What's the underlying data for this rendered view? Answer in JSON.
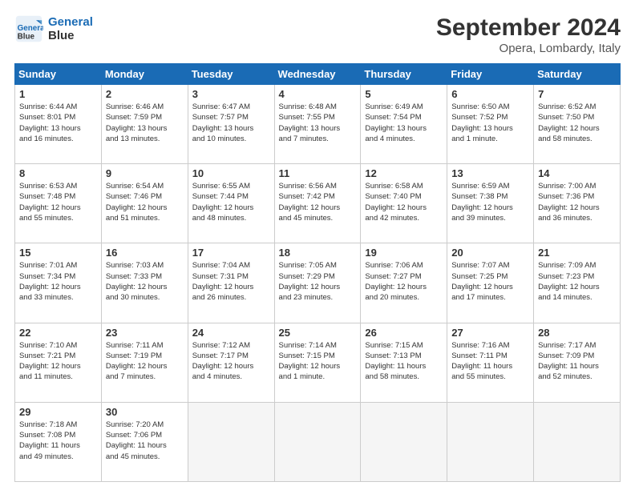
{
  "header": {
    "logo_line1": "General",
    "logo_line2": "Blue",
    "main_title": "September 2024",
    "sub_title": "Opera, Lombardy, Italy"
  },
  "calendar": {
    "days_of_week": [
      "Sunday",
      "Monday",
      "Tuesday",
      "Wednesday",
      "Thursday",
      "Friday",
      "Saturday"
    ],
    "weeks": [
      [
        {
          "day": "1",
          "detail": "Sunrise: 6:44 AM\nSunset: 8:01 PM\nDaylight: 13 hours\nand 16 minutes."
        },
        {
          "day": "2",
          "detail": "Sunrise: 6:46 AM\nSunset: 7:59 PM\nDaylight: 13 hours\nand 13 minutes."
        },
        {
          "day": "3",
          "detail": "Sunrise: 6:47 AM\nSunset: 7:57 PM\nDaylight: 13 hours\nand 10 minutes."
        },
        {
          "day": "4",
          "detail": "Sunrise: 6:48 AM\nSunset: 7:55 PM\nDaylight: 13 hours\nand 7 minutes."
        },
        {
          "day": "5",
          "detail": "Sunrise: 6:49 AM\nSunset: 7:54 PM\nDaylight: 13 hours\nand 4 minutes."
        },
        {
          "day": "6",
          "detail": "Sunrise: 6:50 AM\nSunset: 7:52 PM\nDaylight: 13 hours\nand 1 minute."
        },
        {
          "day": "7",
          "detail": "Sunrise: 6:52 AM\nSunset: 7:50 PM\nDaylight: 12 hours\nand 58 minutes."
        }
      ],
      [
        {
          "day": "8",
          "detail": "Sunrise: 6:53 AM\nSunset: 7:48 PM\nDaylight: 12 hours\nand 55 minutes."
        },
        {
          "day": "9",
          "detail": "Sunrise: 6:54 AM\nSunset: 7:46 PM\nDaylight: 12 hours\nand 51 minutes."
        },
        {
          "day": "10",
          "detail": "Sunrise: 6:55 AM\nSunset: 7:44 PM\nDaylight: 12 hours\nand 48 minutes."
        },
        {
          "day": "11",
          "detail": "Sunrise: 6:56 AM\nSunset: 7:42 PM\nDaylight: 12 hours\nand 45 minutes."
        },
        {
          "day": "12",
          "detail": "Sunrise: 6:58 AM\nSunset: 7:40 PM\nDaylight: 12 hours\nand 42 minutes."
        },
        {
          "day": "13",
          "detail": "Sunrise: 6:59 AM\nSunset: 7:38 PM\nDaylight: 12 hours\nand 39 minutes."
        },
        {
          "day": "14",
          "detail": "Sunrise: 7:00 AM\nSunset: 7:36 PM\nDaylight: 12 hours\nand 36 minutes."
        }
      ],
      [
        {
          "day": "15",
          "detail": "Sunrise: 7:01 AM\nSunset: 7:34 PM\nDaylight: 12 hours\nand 33 minutes."
        },
        {
          "day": "16",
          "detail": "Sunrise: 7:03 AM\nSunset: 7:33 PM\nDaylight: 12 hours\nand 30 minutes."
        },
        {
          "day": "17",
          "detail": "Sunrise: 7:04 AM\nSunset: 7:31 PM\nDaylight: 12 hours\nand 26 minutes."
        },
        {
          "day": "18",
          "detail": "Sunrise: 7:05 AM\nSunset: 7:29 PM\nDaylight: 12 hours\nand 23 minutes."
        },
        {
          "day": "19",
          "detail": "Sunrise: 7:06 AM\nSunset: 7:27 PM\nDaylight: 12 hours\nand 20 minutes."
        },
        {
          "day": "20",
          "detail": "Sunrise: 7:07 AM\nSunset: 7:25 PM\nDaylight: 12 hours\nand 17 minutes."
        },
        {
          "day": "21",
          "detail": "Sunrise: 7:09 AM\nSunset: 7:23 PM\nDaylight: 12 hours\nand 14 minutes."
        }
      ],
      [
        {
          "day": "22",
          "detail": "Sunrise: 7:10 AM\nSunset: 7:21 PM\nDaylight: 12 hours\nand 11 minutes."
        },
        {
          "day": "23",
          "detail": "Sunrise: 7:11 AM\nSunset: 7:19 PM\nDaylight: 12 hours\nand 7 minutes."
        },
        {
          "day": "24",
          "detail": "Sunrise: 7:12 AM\nSunset: 7:17 PM\nDaylight: 12 hours\nand 4 minutes."
        },
        {
          "day": "25",
          "detail": "Sunrise: 7:14 AM\nSunset: 7:15 PM\nDaylight: 12 hours\nand 1 minute."
        },
        {
          "day": "26",
          "detail": "Sunrise: 7:15 AM\nSunset: 7:13 PM\nDaylight: 11 hours\nand 58 minutes."
        },
        {
          "day": "27",
          "detail": "Sunrise: 7:16 AM\nSunset: 7:11 PM\nDaylight: 11 hours\nand 55 minutes."
        },
        {
          "day": "28",
          "detail": "Sunrise: 7:17 AM\nSunset: 7:09 PM\nDaylight: 11 hours\nand 52 minutes."
        }
      ],
      [
        {
          "day": "29",
          "detail": "Sunrise: 7:18 AM\nSunset: 7:08 PM\nDaylight: 11 hours\nand 49 minutes."
        },
        {
          "day": "30",
          "detail": "Sunrise: 7:20 AM\nSunset: 7:06 PM\nDaylight: 11 hours\nand 45 minutes."
        },
        {
          "day": "",
          "detail": ""
        },
        {
          "day": "",
          "detail": ""
        },
        {
          "day": "",
          "detail": ""
        },
        {
          "day": "",
          "detail": ""
        },
        {
          "day": "",
          "detail": ""
        }
      ]
    ]
  }
}
